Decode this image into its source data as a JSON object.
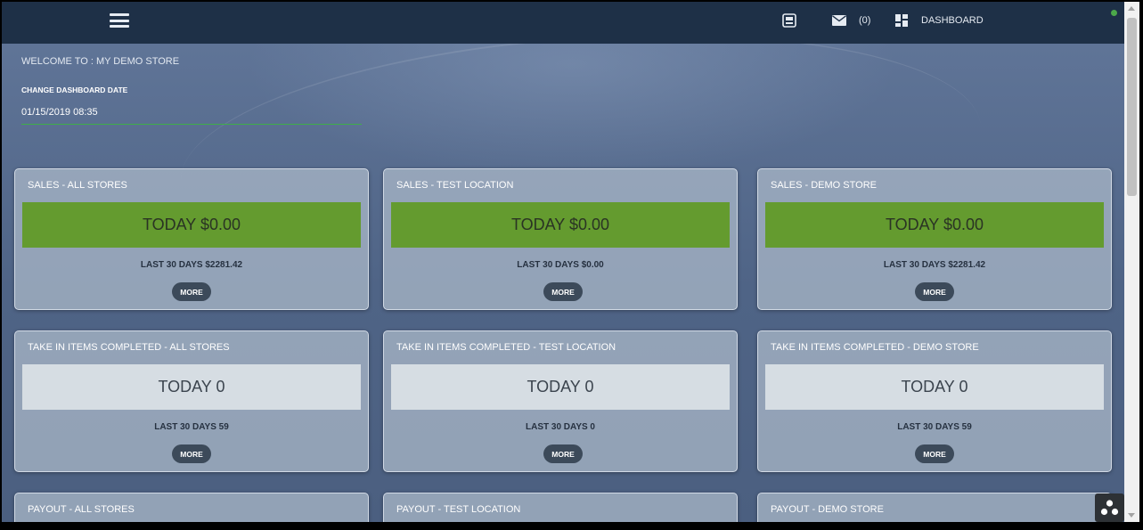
{
  "header": {
    "mail_count": "(0)",
    "dashboard_label": "DASHBOARD"
  },
  "page": {
    "welcome": "WELCOME TO : MY DEMO STORE",
    "date_label": "CHANGE DASHBOARD DATE",
    "date_value": "01/15/2019 08:35"
  },
  "cards": {
    "sales_all": {
      "title": "SALES - ALL STORES",
      "today": "TODAY $0.00",
      "last30": "LAST 30 DAYS $2281.42",
      "more": "MORE"
    },
    "sales_test": {
      "title": "SALES - TEST LOCATION",
      "today": "TODAY $0.00",
      "last30": "LAST 30 DAYS $0.00",
      "more": "MORE"
    },
    "sales_demo": {
      "title": "SALES - DEMO STORE",
      "today": "TODAY $0.00",
      "last30": "LAST 30 DAYS $2281.42",
      "more": "MORE"
    },
    "takein_all": {
      "title": "TAKE IN ITEMS COMPLETED - ALL STORES",
      "today": "TODAY 0",
      "last30": "LAST 30 DAYS 59",
      "more": "MORE"
    },
    "takein_test": {
      "title": "TAKE IN ITEMS COMPLETED - TEST LOCATION",
      "today": "TODAY 0",
      "last30": "LAST 30 DAYS 0",
      "more": "MORE"
    },
    "takein_demo": {
      "title": "TAKE IN ITEMS COMPLETED - DEMO STORE",
      "today": "TODAY 0",
      "last30": "LAST 30 DAYS 59",
      "more": "MORE"
    },
    "payout_all": {
      "title": "PAYOUT - ALL STORES"
    },
    "payout_test": {
      "title": "PAYOUT - TEST LOCATION"
    },
    "payout_demo": {
      "title": "PAYOUT - DEMO STORE"
    }
  },
  "icons": {
    "menu": "hamburger-menu-icon",
    "register": "register-icon",
    "mail": "mail-icon",
    "dashboard": "dashboard-grid-icon",
    "status": "status-dot-icon",
    "help": "help-launcher-icon"
  },
  "colors": {
    "topbar": "#1e3047",
    "sales_today": "#649b2f",
    "status_dot": "#4ca84a",
    "date_underline": "#3fae49"
  }
}
